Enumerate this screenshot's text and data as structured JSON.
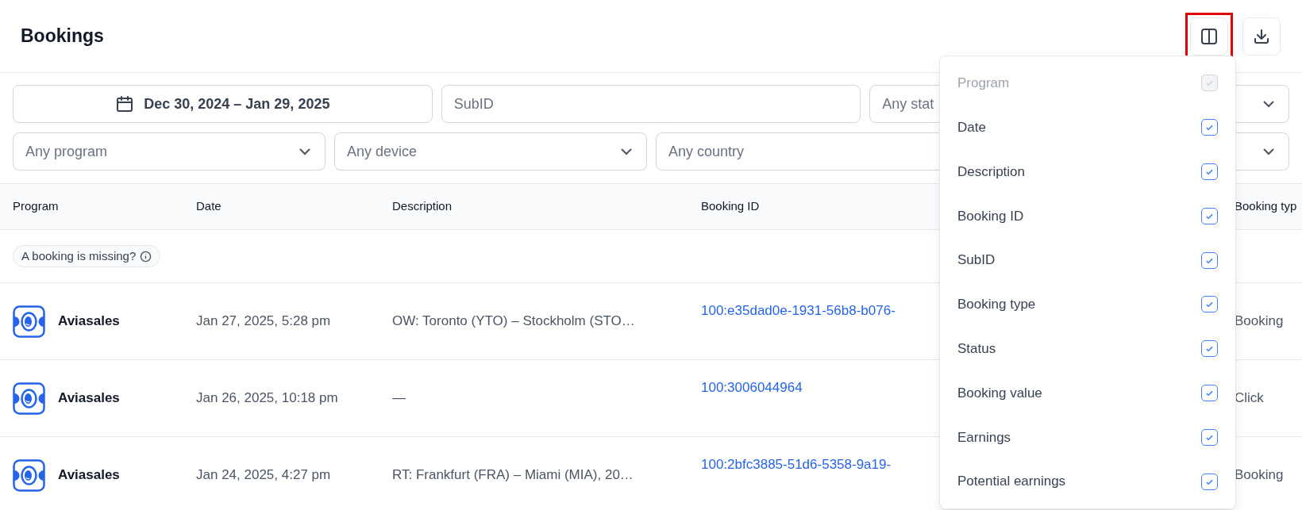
{
  "page": {
    "title": "Bookings"
  },
  "toolbar": {
    "columns_button": {
      "highlighted": true
    }
  },
  "filters": {
    "date_range": "Dec 30, 2024 – Jan 29, 2025",
    "subid": {
      "placeholder": "SubID"
    },
    "status": {
      "placeholder": "Any stat"
    },
    "program": {
      "placeholder": "Any program"
    },
    "device": {
      "placeholder": "Any device"
    },
    "country": {
      "placeholder": "Any country"
    }
  },
  "table": {
    "columns": [
      "Program",
      "Date",
      "Description",
      "Booking ID",
      "Booking typ"
    ],
    "missing_hint": "A booking is missing?",
    "rows": [
      {
        "program": "Aviasales",
        "date": "Jan 27, 2025, 5:28 pm",
        "description": "OW: Toronto (YTO) – Stockholm (STO…",
        "booking_id": "100:e35dad0e-1931-56b8-b076-",
        "booking_type": "Booking"
      },
      {
        "program": "Aviasales",
        "date": "Jan 26, 2025, 10:18 pm",
        "description": "—",
        "booking_id": "100:3006044964",
        "booking_type": "Click"
      },
      {
        "program": "Aviasales",
        "date": "Jan 24, 2025, 4:27 pm",
        "description": "RT: Frankfurt (FRA) – Miami (MIA), 20…",
        "booking_id": "100:2bfc3885-51d6-5358-9a19-",
        "booking_type": "Booking"
      }
    ]
  },
  "column_menu": {
    "items": [
      {
        "label": "Program",
        "checked": true,
        "disabled": true
      },
      {
        "label": "Date",
        "checked": true,
        "disabled": false
      },
      {
        "label": "Description",
        "checked": true,
        "disabled": false
      },
      {
        "label": "Booking ID",
        "checked": true,
        "disabled": false
      },
      {
        "label": "SubID",
        "checked": true,
        "disabled": false
      },
      {
        "label": "Booking type",
        "checked": true,
        "disabled": false
      },
      {
        "label": "Status",
        "checked": true,
        "disabled": false
      },
      {
        "label": "Booking value",
        "checked": true,
        "disabled": false
      },
      {
        "label": "Earnings",
        "checked": true,
        "disabled": false
      },
      {
        "label": "Potential earnings",
        "checked": true,
        "disabled": false
      }
    ]
  }
}
